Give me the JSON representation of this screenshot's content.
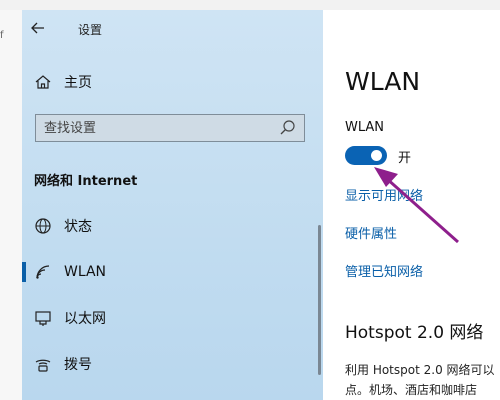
{
  "background_window": {
    "cut_text": "f"
  },
  "sidebar": {
    "title": "设置",
    "home_label": "主页",
    "search_placeholder": "查找设置",
    "section_title": "网络和 Internet",
    "items": [
      {
        "label": "状态",
        "icon": "globe-icon"
      },
      {
        "label": "WLAN",
        "icon": "wifi-icon",
        "selected": true
      },
      {
        "label": "以太网",
        "icon": "ethernet-icon"
      },
      {
        "label": "拨号",
        "icon": "dial-up-icon"
      }
    ]
  },
  "main": {
    "title": "WLAN",
    "wlan_label": "WLAN",
    "toggle_state": "开",
    "toggle_on": true,
    "links": [
      "显示可用网络",
      "硬件属性",
      "管理已知网络"
    ],
    "hotspot_title": "Hotspot 2.0 网络",
    "hotspot_desc_line1": "利用 Hotspot 2.0 网络可以",
    "hotspot_desc_line2": "点。机场、酒店和咖啡店"
  },
  "colors": {
    "accent": "#0a63b4",
    "link": "#0a5fa8",
    "annotation_arrow": "#8e1f8c",
    "sidebar_bg": "#c4ddf0"
  }
}
